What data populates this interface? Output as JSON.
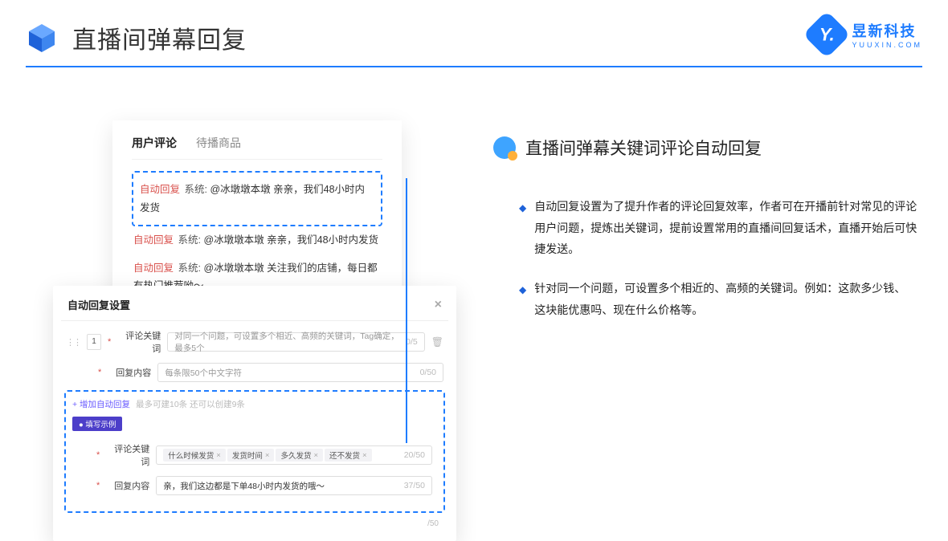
{
  "header": {
    "title": "直播间弹幕回复",
    "brand_name": "昱新科技",
    "brand_sub": "YUUXIN.COM"
  },
  "cardA": {
    "tab_active": "用户评论",
    "tab_other": "待播商品",
    "c1_tag": "自动回复",
    "c1_sys": "系统:",
    "c1_txt": "@冰墩墩本墩 亲亲，我们48小时内发货",
    "c2_tag": "自动回复",
    "c2_sys": "系统:",
    "c2_txt": "@冰墩墩本墩 亲亲，我们48小时内发货",
    "c3_tag": "自动回复",
    "c3_sys": "系统:",
    "c3_txt": "@冰墩墩本墩 关注我们的店铺，每日都有热门推荐呦～"
  },
  "cardB": {
    "title": "自动回复设置",
    "idx": "1",
    "lbl_kw": "评论关键词",
    "ph_kw": "对同一个问题，可设置多个相近、高频的关键词，Tag确定，最多5个",
    "cnt_kw": "0/5",
    "lbl_ct": "回复内容",
    "ph_ct": "每条限50个中文字符",
    "cnt_ct": "0/50",
    "add": "+ 增加自动回复",
    "add_hint": "最多可建10条 还可以创建9条",
    "badge": "● 填写示例",
    "ex_kw_lbl": "评论关键词",
    "tags": [
      "什么时候发货",
      "发货时间",
      "多久发货",
      "还不发货"
    ],
    "ex_kw_cnt": "20/50",
    "ex_ct_lbl": "回复内容",
    "ex_ct_val": "亲，我们这边都是下单48小时内发货的哦～",
    "ex_ct_cnt": "37/50",
    "tail_cnt": "/50"
  },
  "right": {
    "title": "直播间弹幕关键词评论自动回复",
    "b1": "自动回复设置为了提升作者的评论回复效率，作者可在开播前针对常见的评论用户问题，提炼出关键词，提前设置常用的直播间回复话术，直播开始后可快捷发送。",
    "b2": "针对同一个问题，可设置多个相近的、高频的关键词。例如：这款多少钱、这块能优惠吗、现在什么价格等。"
  }
}
